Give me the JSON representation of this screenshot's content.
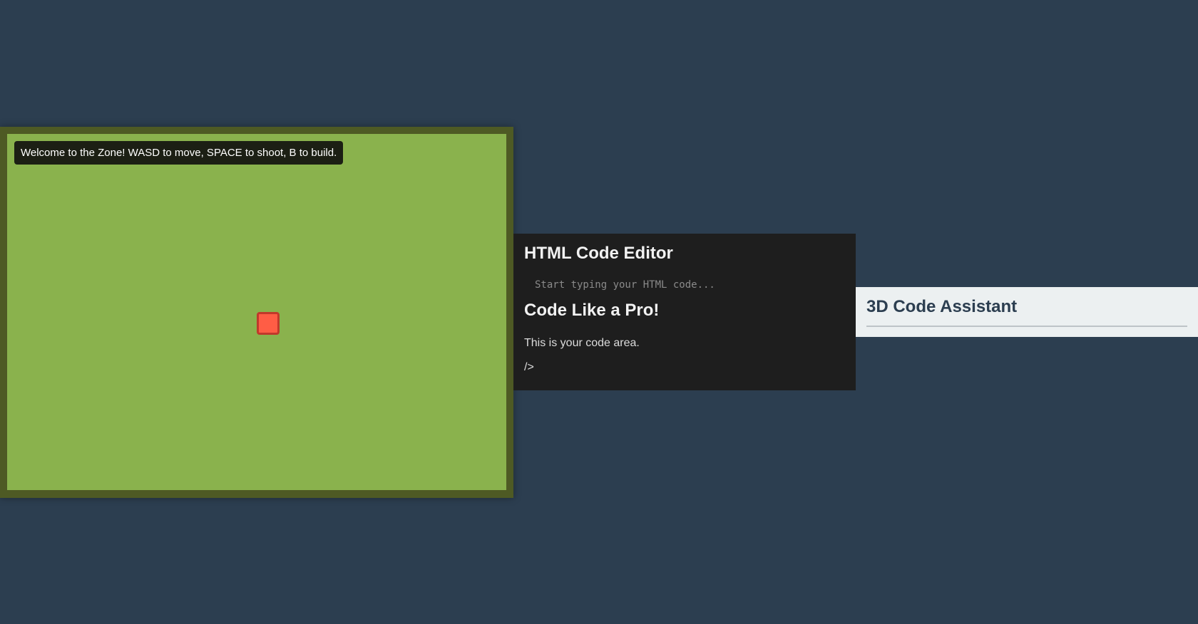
{
  "game": {
    "hud_text": "Welcome to the Zone! WASD to move, SPACE to shoot, B to build.",
    "colors": {
      "field": "#8ab24d",
      "frame": "#4e5a24",
      "player": "#ff5d45",
      "player_border": "#c0392b"
    }
  },
  "editor": {
    "title": "HTML Code Editor",
    "input_placeholder": "Start typing your HTML code...",
    "heading": "Code Like a Pro!",
    "paragraph": "This is your code area.",
    "tag_text": "/>"
  },
  "assistant": {
    "title": "3D Code Assistant"
  },
  "theme": {
    "background": "#2c3e50",
    "editor_bg": "#1e1e1e",
    "assistant_bg": "#ecf0f1"
  }
}
